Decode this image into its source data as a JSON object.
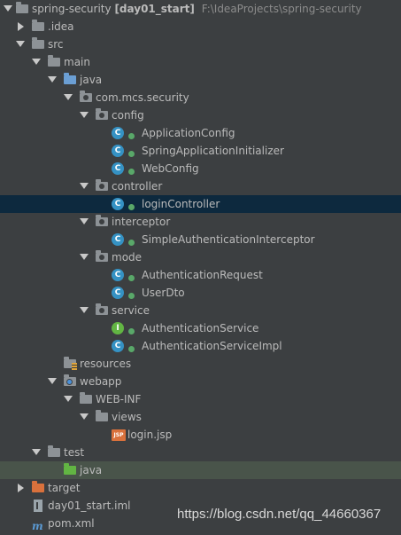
{
  "project": {
    "name": "spring-security",
    "module": "[day01_start]",
    "path": "F:\\IdeaProjects\\spring-security"
  },
  "tree": {
    "idea": ".idea",
    "src": "src",
    "main": "main",
    "java": "java",
    "package": "com.mcs.security",
    "config": "config",
    "application_config": "ApplicationConfig",
    "spring_app_initializer": "SpringApplicationInitializer",
    "web_config": "WebConfig",
    "controller": "controller",
    "login_controller": "loginController",
    "interceptor": "interceptor",
    "simple_auth_interceptor": "SimpleAuthenticationInterceptor",
    "mode": "mode",
    "authentication_request": "AuthenticationRequest",
    "user_dto": "UserDto",
    "service": "service",
    "authentication_service": "AuthenticationService",
    "authentication_service_impl": "AuthenticationServiceImpl",
    "resources": "resources",
    "webapp": "webapp",
    "web_inf": "WEB-INF",
    "views": "views",
    "login_jsp": "login.jsp",
    "test": "test",
    "test_java": "java",
    "target": "target",
    "iml_file": "day01_start.iml",
    "pom": "pom.xml"
  },
  "icons": {
    "class_letter": "C",
    "interface_letter": "I",
    "jsp_badge": "JSP",
    "maven_letter": "m"
  },
  "watermark": "https://blog.csdn.net/qq_44660367",
  "colors": {
    "background": "#3c3f41",
    "selection": "#0d293e",
    "test_highlight": "#49544a",
    "class_icon": "#3592c4",
    "interface_icon": "#62b543",
    "test_folder": "#62b543",
    "target_folder": "#d9713c",
    "source_folder": "#6b9fd4"
  }
}
